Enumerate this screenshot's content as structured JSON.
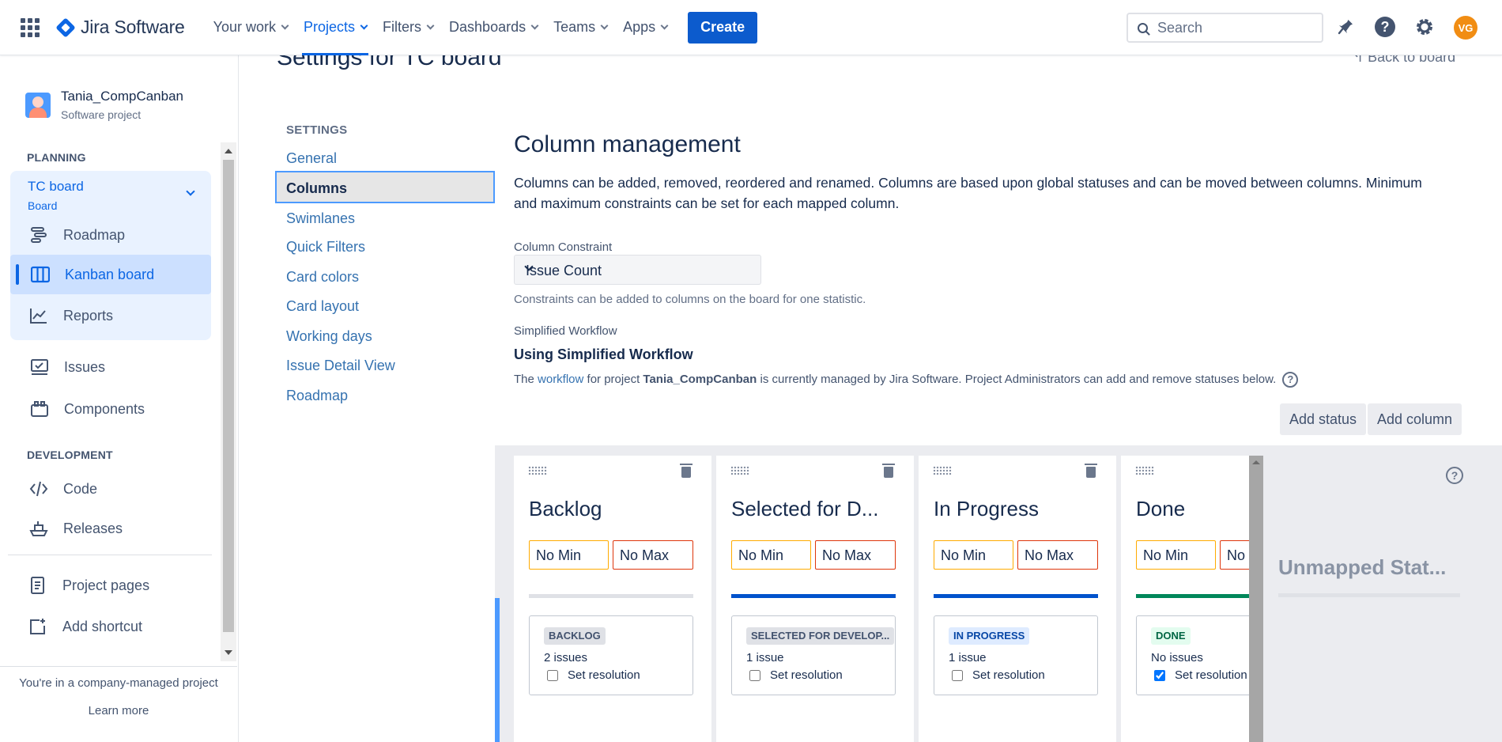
{
  "topnav": {
    "logo_text": "Jira Software",
    "items": [
      {
        "label": "Your work"
      },
      {
        "label": "Projects"
      },
      {
        "label": "Filters"
      },
      {
        "label": "Dashboards"
      },
      {
        "label": "Teams"
      },
      {
        "label": "Apps"
      }
    ],
    "active_item": "Projects",
    "create_label": "Create",
    "search_placeholder": "Search",
    "avatar_initials": "VG",
    "brand_color": "#0c66e4",
    "avatar_color": "#f18d13"
  },
  "sidebar": {
    "project_name": "Tania_CompCanban",
    "project_type": "Software project",
    "planning_label": "PLANNING",
    "board_name": "TC board",
    "board_type": "Board",
    "planning_items": [
      {
        "label": "Roadmap",
        "icon": "roadmap-icon"
      },
      {
        "label": "Kanban board",
        "icon": "kanban-board-icon"
      },
      {
        "label": "Reports",
        "icon": "reports-icon"
      }
    ],
    "other_items": [
      {
        "label": "Issues",
        "icon": "issues-icon"
      },
      {
        "label": "Components",
        "icon": "components-icon"
      }
    ],
    "development_label": "DEVELOPMENT",
    "development_items": [
      {
        "label": "Code",
        "icon": "code-icon"
      },
      {
        "label": "Releases",
        "icon": "releases-icon"
      }
    ],
    "bottom_items": [
      {
        "label": "Project pages",
        "icon": "project-pages-icon"
      },
      {
        "label": "Add shortcut",
        "icon": "add-shortcut-icon"
      }
    ],
    "company_text": "You're in a company-managed project",
    "learn_more": "Learn more"
  },
  "main": {
    "page_title": "Settings for TC board",
    "back_link": "Back to board",
    "settings_heading": "SETTINGS",
    "settings_links": [
      "General",
      "Columns",
      "Swimlanes",
      "Quick Filters",
      "Card colors",
      "Card layout",
      "Working days",
      "Issue Detail View",
      "Roadmap"
    ],
    "active_setting": "Columns",
    "section_title": "Column management",
    "section_desc": "Columns can be added, removed, reordered and renamed. Columns are based upon global statuses and can be moved between columns. Minimum and maximum constraints can be set for each mapped column.",
    "constraint_label": "Column Constraint",
    "constraint_value": "Issue Count",
    "constraint_hint": "Constraints can be added to columns on the board for one statistic.",
    "workflow_label": "Simplified Workflow",
    "workflow_title": "Using Simplified Workflow",
    "workflow_desc_1": "The ",
    "workflow_link": "workflow",
    "workflow_desc_2": " for project ",
    "workflow_project": "Tania_CompCanban",
    "workflow_desc_3": " is currently managed by Jira Software. Project Administrators can add and remove statuses below.",
    "add_status": "Add status",
    "add_column": "Add column"
  },
  "columns": [
    {
      "title": "Backlog",
      "min": "No Min",
      "max": "No Max",
      "status": "BACKLOG",
      "count": "2 issues",
      "resolution": "Set resolution",
      "checked": false,
      "bar_color": "#dfe1e6",
      "lozenge_bg": "#dfe1e6",
      "lozenge_fg": "#42526e"
    },
    {
      "title": "Selected for D...",
      "min": "No Min",
      "max": "No Max",
      "status": "SELECTED FOR DEVELOP...",
      "count": "1 issue",
      "resolution": "Set resolution",
      "checked": false,
      "bar_color": "#0052cc",
      "lozenge_bg": "#dfe1e6",
      "lozenge_fg": "#42526e"
    },
    {
      "title": "In Progress",
      "min": "No Min",
      "max": "No Max",
      "status": "IN PROGRESS",
      "count": "1 issue",
      "resolution": "Set resolution",
      "checked": false,
      "bar_color": "#0052cc",
      "lozenge_bg": "#deebff",
      "lozenge_fg": "#0747a6"
    },
    {
      "title": "Done",
      "min": "No Min",
      "max": "No",
      "status": "DONE",
      "count": "No issues",
      "resolution": "Set resolution",
      "checked": true,
      "bar_color": "#00875a",
      "lozenge_bg": "#e3fcef",
      "lozenge_fg": "#006644"
    }
  ],
  "unmapped_title": "Unmapped Stat..."
}
